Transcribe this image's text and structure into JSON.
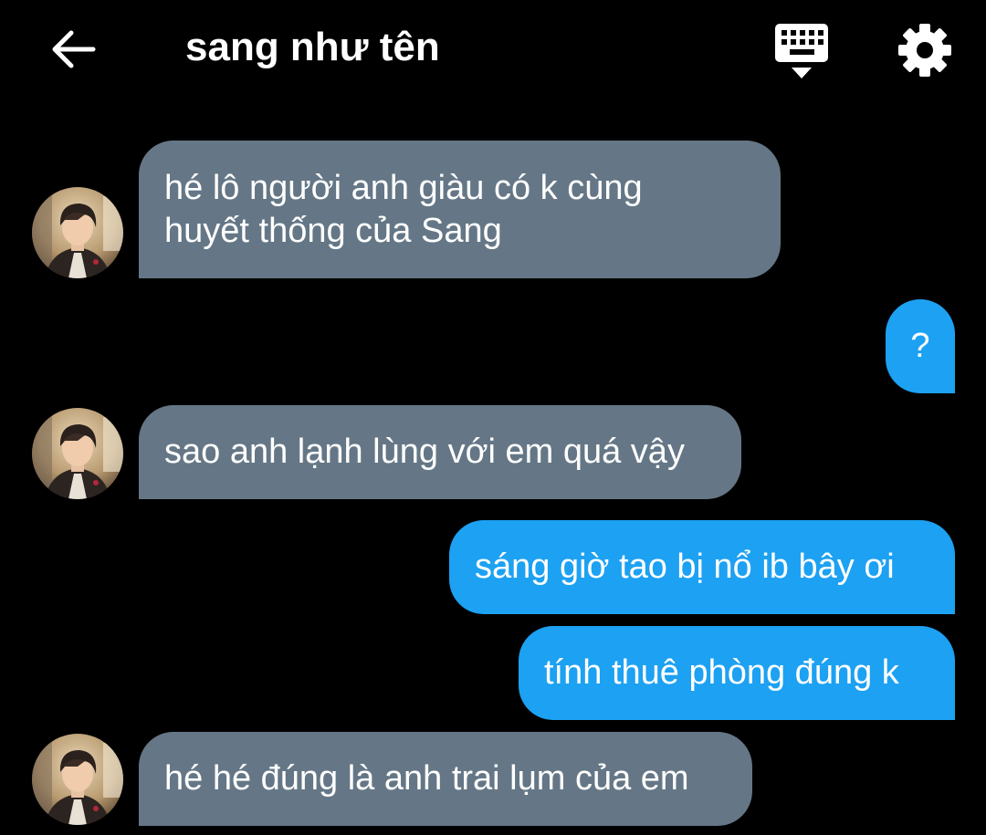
{
  "header": {
    "title": "sang như tên",
    "back_icon": "arrow-left-icon",
    "keyboard_icon": "keyboard-icon",
    "settings_icon": "gear-icon"
  },
  "colors": {
    "background": "#000000",
    "received_bubble": "#657786",
    "sent_bubble": "#1da1f2",
    "text": "#ffffff"
  },
  "messages": [
    {
      "direction": "received",
      "text": "hé lô người anh giàu có k cùng\nhuyết thống của Sang",
      "avatar": "avatar"
    },
    {
      "direction": "sent",
      "text": "?"
    },
    {
      "direction": "received",
      "text": "sao anh lạnh lùng với em quá vậy",
      "avatar": "avatar"
    },
    {
      "direction": "sent",
      "text": "sáng giờ tao bị nổ ib bây ơi"
    },
    {
      "direction": "sent",
      "text": "tính thuê phòng đúng k"
    },
    {
      "direction": "received",
      "text": "hé hé đúng là anh trai lụm của em",
      "avatar": "avatar"
    }
  ]
}
